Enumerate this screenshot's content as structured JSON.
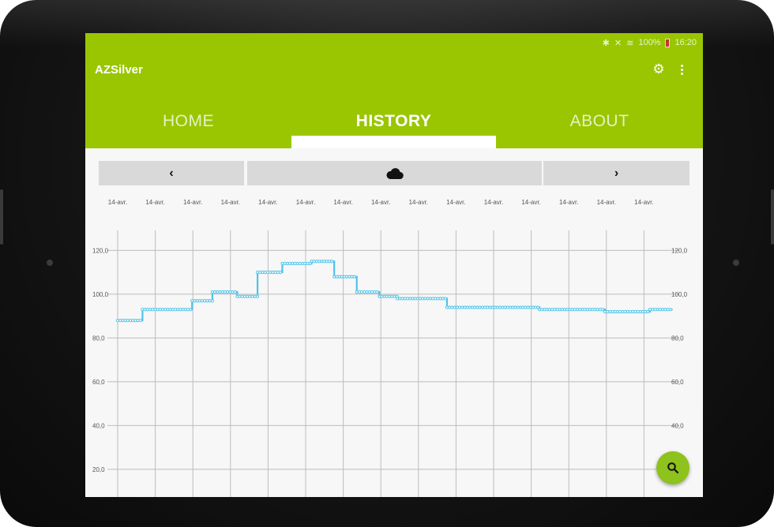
{
  "status_bar": {
    "icons": [
      "bluetooth-icon",
      "signal-icon",
      "wifi-icon"
    ],
    "battery": "100%",
    "time": "16:20"
  },
  "app_bar": {
    "title": "AZSilver",
    "settings_icon": "gear-icon",
    "menu_icon": "more-vert-icon",
    "color": "#99c601"
  },
  "tabs": [
    {
      "label": "HOME",
      "active": false
    },
    {
      "label": "HISTORY",
      "active": true
    },
    {
      "label": "ABOUT",
      "active": false
    }
  ],
  "nav": {
    "prev_label": "‹",
    "center_icon": "cloud-icon",
    "next_label": "›"
  },
  "fab": {
    "icon": "search-icon",
    "color": "#8ec21c"
  },
  "chart_data": {
    "type": "line",
    "x_tick_labels": [
      "14-avr.",
      "14-avr.",
      "14-avr.",
      "14-avr.",
      "14-avr.",
      "14-avr.",
      "14-avr.",
      "14-avr.",
      "14-avr.",
      "14-avr.",
      "14-avr.",
      "14-avr.",
      "14-avr.",
      "14-avr.",
      "14-avr."
    ],
    "y_ticks": [
      20,
      40,
      60,
      80,
      100,
      120
    ],
    "y_tick_labels": [
      "20,0",
      "40,0",
      "60,0",
      "80,0",
      "100,0",
      "120,0"
    ],
    "ylim": [
      3,
      127
    ],
    "grid": true,
    "line_color": "#4ec3e8",
    "series": [
      {
        "segments": [
          {
            "x0": 0,
            "x1": 0.66,
            "y": 88
          },
          {
            "x0": 0.66,
            "x1": 1.98,
            "y": 93
          },
          {
            "x0": 1.98,
            "x1": 2.52,
            "y": 97
          },
          {
            "x0": 2.52,
            "x1": 3.18,
            "y": 101
          },
          {
            "x0": 3.18,
            "x1": 3.72,
            "y": 99
          },
          {
            "x0": 3.72,
            "x1": 4.38,
            "y": 110
          },
          {
            "x0": 4.38,
            "x1": 5.16,
            "y": 114
          },
          {
            "x0": 5.16,
            "x1": 5.76,
            "y": 115
          },
          {
            "x0": 5.76,
            "x1": 6.36,
            "y": 108
          },
          {
            "x0": 6.36,
            "x1": 6.96,
            "y": 101
          },
          {
            "x0": 6.96,
            "x1": 7.44,
            "y": 99
          },
          {
            "x0": 7.44,
            "x1": 8.76,
            "y": 98
          },
          {
            "x0": 8.76,
            "x1": 11.22,
            "y": 94
          },
          {
            "x0": 11.22,
            "x1": 12.96,
            "y": 93
          },
          {
            "x0": 12.96,
            "x1": 14.16,
            "y": 92
          },
          {
            "x0": 14.16,
            "x1": 14.76,
            "y": 93
          }
        ]
      }
    ]
  }
}
